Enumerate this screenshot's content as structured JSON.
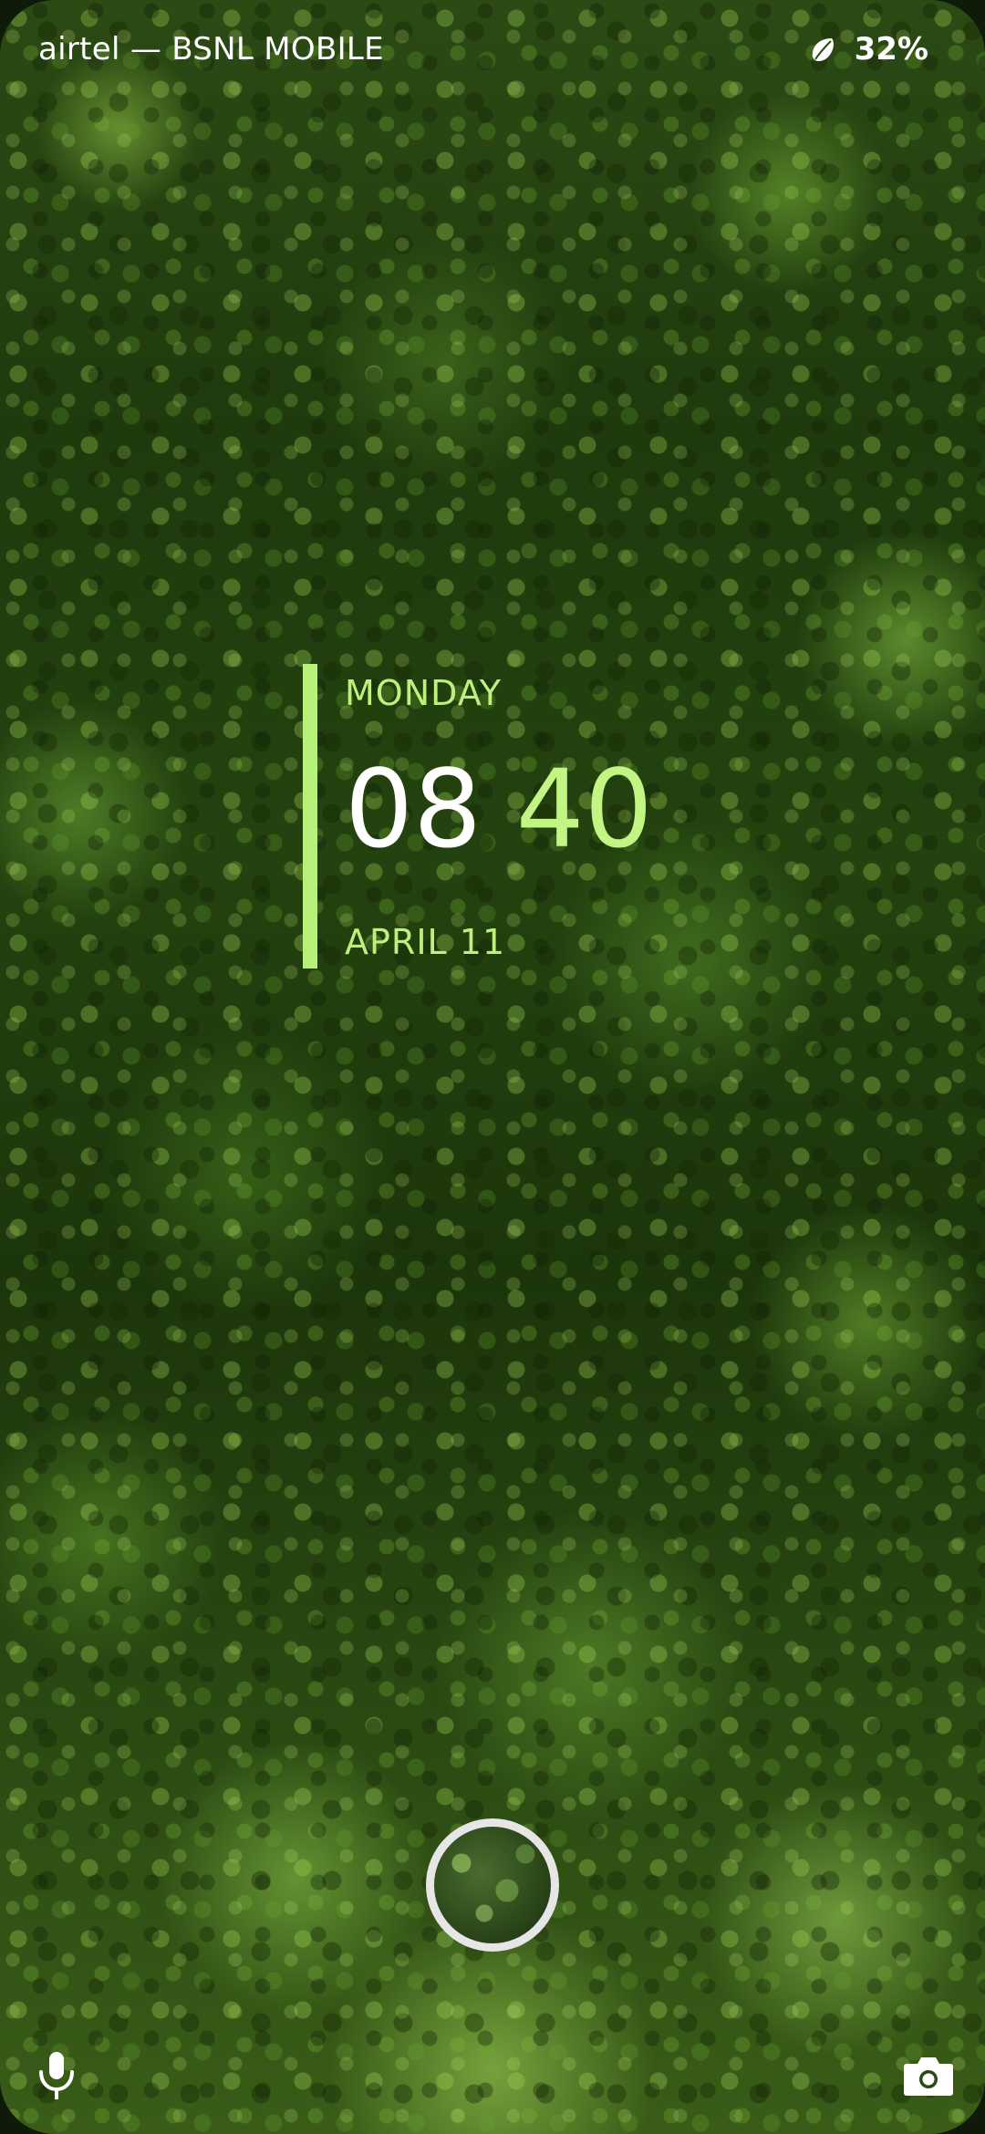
{
  "status_bar": {
    "carrier": "airtel — BSNL MOBILE",
    "battery_percent": "32%",
    "battery_icon": "battery-saver-icon"
  },
  "clock": {
    "day": "MONDAY",
    "hour": "08",
    "minute": "40",
    "date": "APRIL 11",
    "accent_color": "#b6f27a"
  },
  "lockscreen": {
    "center_control": "fingerprint-unlock",
    "left_shortcut_icon": "microphone-icon",
    "right_shortcut_icon": "camera-icon"
  }
}
